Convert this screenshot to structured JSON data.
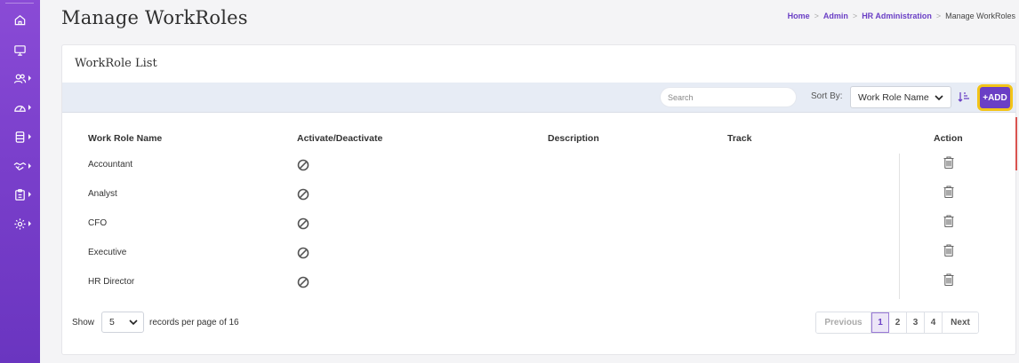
{
  "sidebar": {
    "items": [
      {
        "icon": "home-icon",
        "has_caret": false
      },
      {
        "icon": "monitor-icon",
        "has_caret": false
      },
      {
        "icon": "users-icon",
        "has_caret": true
      },
      {
        "icon": "dashboard-gauge-icon",
        "has_caret": true
      },
      {
        "icon": "database-icon",
        "has_caret": true
      },
      {
        "icon": "handshake-icon",
        "has_caret": true
      },
      {
        "icon": "clipboard-icon",
        "has_caret": true
      },
      {
        "icon": "settings-gear-icon",
        "has_caret": true
      }
    ]
  },
  "header": {
    "title": "Manage WorkRoles",
    "breadcrumb": {
      "home": "Home",
      "admin": "Admin",
      "hr_admin": "HR Administration",
      "current": "Manage WorkRoles",
      "separator": ">"
    }
  },
  "card": {
    "title": "WorkRole List",
    "toolbar": {
      "search_placeholder": "Search",
      "sort_label": "Sort By:",
      "sort_value": "Work Role Name",
      "add_label": "+ADD"
    },
    "table": {
      "columns": [
        "Work Role Name",
        "Activate/Deactivate",
        "Description",
        "Track",
        "Action"
      ],
      "rows": [
        {
          "name": "Accountant"
        },
        {
          "name": "Analyst"
        },
        {
          "name": "CFO"
        },
        {
          "name": "Executive"
        },
        {
          "name": "HR Director"
        }
      ]
    },
    "footer": {
      "show_label": "Show",
      "records_per_page": "5",
      "records_suffix": "records per page of 16",
      "pagination": {
        "previous": "Previous",
        "pages": [
          "1",
          "2",
          "3",
          "4"
        ],
        "active_page": "1",
        "next": "Next"
      }
    }
  },
  "colors": {
    "brand_purple": "#6a3fc5",
    "sidebar_gradient_top": "#8a4bd6",
    "add_button_highlight": "#f2c418",
    "toolbar_bg": "#e7ecf5"
  }
}
